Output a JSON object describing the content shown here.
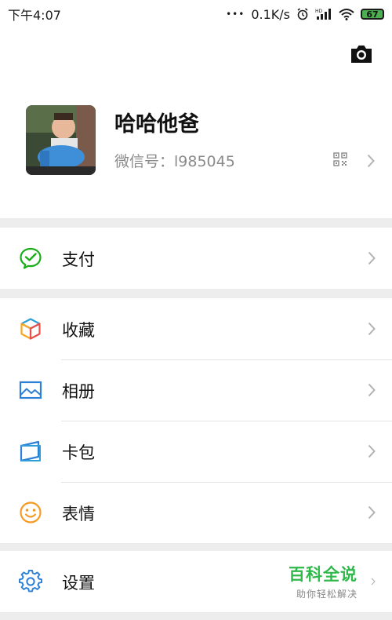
{
  "status_bar": {
    "time": "下午4:07",
    "more": "•••",
    "speed": "0.1K/s",
    "battery": "67",
    "icons": [
      "alarm-icon",
      "signal-icon",
      "wifi-icon",
      "battery-icon"
    ]
  },
  "profile": {
    "nickname": "哈哈他爸",
    "wechat_id": "微信号：l985045"
  },
  "menu_groups": [
    [
      {
        "label": "支付",
        "icon": "wechat-pay-icon",
        "color": "#1aad19"
      }
    ],
    [
      {
        "label": "收藏",
        "icon": "favorites-cube-icon",
        "color": "#f5a623"
      },
      {
        "label": "相册",
        "icon": "album-icon",
        "color": "#2e7fd6"
      },
      {
        "label": "卡包",
        "icon": "card-wallet-icon",
        "color": "#2e7fd6"
      },
      {
        "label": "表情",
        "icon": "sticker-smile-icon",
        "color": "#f59a23"
      }
    ],
    [
      {
        "label": "设置",
        "icon": "settings-gear-icon",
        "color": "#2e7fd6"
      }
    ]
  ],
  "watermark": {
    "title": "百科全说",
    "subtitle": "助你轻松解决"
  }
}
